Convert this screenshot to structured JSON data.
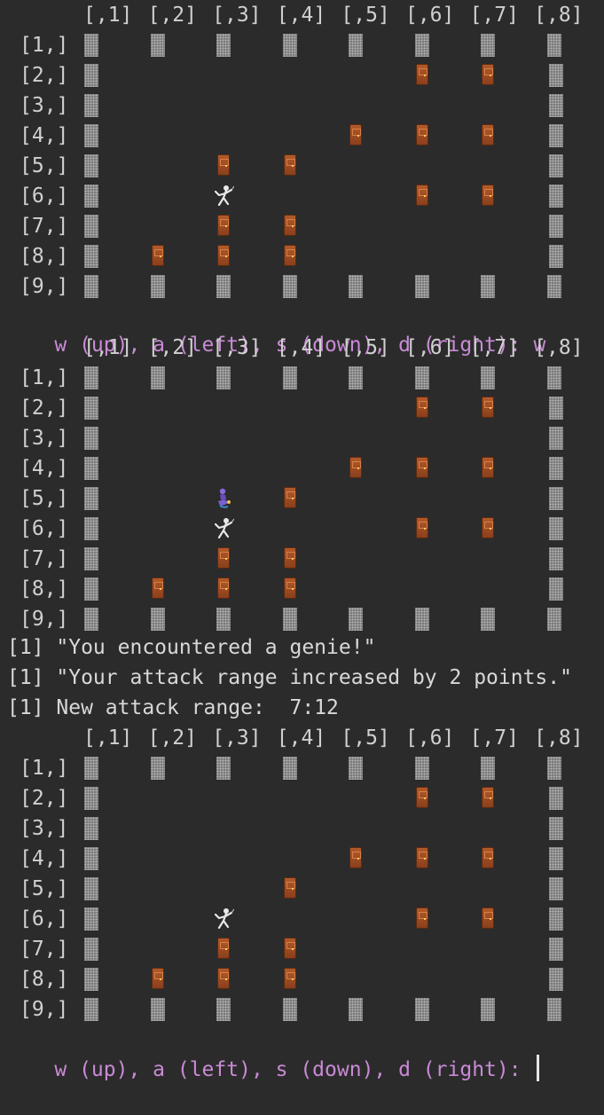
{
  "columns": [
    "[,1]",
    "[,2]",
    "[,3]",
    "[,4]",
    "[,5]",
    "[,6]",
    "[,7]",
    "[,8]"
  ],
  "rows": [
    "[1,]",
    "[2,]",
    "[3,]",
    "[4,]",
    "[5,]",
    "[6,]",
    "[7,]",
    "[8,]",
    "[9,]"
  ],
  "prompt_text": "w (up), a (left), s (down), d (right): ",
  "first_input": "w",
  "messages": [
    "[1] \"You encountered a genie!\"",
    "[1] \"Your attack range increased by 2 points.\"",
    "[1] New attack range:  7:12"
  ],
  "legend": {
    "wall_icon": "textured-wall-block",
    "door_icon": "wooden-door",
    "player_icon": "fencer",
    "genie_icon": "genie"
  },
  "colors": {
    "background": "#2b2b2b",
    "text": "#d0d0d0",
    "prompt": "#c98ad6"
  },
  "boards": [
    {
      "walls": [
        [
          1,
          1
        ],
        [
          1,
          2
        ],
        [
          1,
          3
        ],
        [
          1,
          4
        ],
        [
          1,
          5
        ],
        [
          1,
          6
        ],
        [
          1,
          7
        ],
        [
          1,
          8
        ],
        [
          2,
          1
        ],
        [
          2,
          8
        ],
        [
          3,
          1
        ],
        [
          3,
          8
        ],
        [
          4,
          1
        ],
        [
          4,
          8
        ],
        [
          5,
          1
        ],
        [
          5,
          8
        ],
        [
          6,
          1
        ],
        [
          6,
          8
        ],
        [
          7,
          1
        ],
        [
          7,
          8
        ],
        [
          8,
          1
        ],
        [
          8,
          8
        ],
        [
          9,
          1
        ],
        [
          9,
          2
        ],
        [
          9,
          3
        ],
        [
          9,
          4
        ],
        [
          9,
          5
        ],
        [
          9,
          6
        ],
        [
          9,
          7
        ],
        [
          9,
          8
        ]
      ],
      "doors": [
        [
          2,
          6
        ],
        [
          2,
          7
        ],
        [
          4,
          5
        ],
        [
          4,
          6
        ],
        [
          4,
          7
        ],
        [
          5,
          3
        ],
        [
          5,
          4
        ],
        [
          6,
          6
        ],
        [
          6,
          7
        ],
        [
          7,
          3
        ],
        [
          7,
          4
        ],
        [
          8,
          2
        ],
        [
          8,
          3
        ],
        [
          8,
          4
        ]
      ],
      "player": [
        6,
        3
      ],
      "genie": null
    },
    {
      "walls": [
        [
          1,
          1
        ],
        [
          1,
          2
        ],
        [
          1,
          3
        ],
        [
          1,
          4
        ],
        [
          1,
          5
        ],
        [
          1,
          6
        ],
        [
          1,
          7
        ],
        [
          1,
          8
        ],
        [
          2,
          1
        ],
        [
          2,
          8
        ],
        [
          3,
          1
        ],
        [
          3,
          8
        ],
        [
          4,
          1
        ],
        [
          4,
          8
        ],
        [
          5,
          1
        ],
        [
          5,
          8
        ],
        [
          6,
          1
        ],
        [
          6,
          8
        ],
        [
          7,
          1
        ],
        [
          7,
          8
        ],
        [
          8,
          1
        ],
        [
          8,
          8
        ],
        [
          9,
          1
        ],
        [
          9,
          2
        ],
        [
          9,
          3
        ],
        [
          9,
          4
        ],
        [
          9,
          5
        ],
        [
          9,
          6
        ],
        [
          9,
          7
        ],
        [
          9,
          8
        ]
      ],
      "doors": [
        [
          2,
          6
        ],
        [
          2,
          7
        ],
        [
          4,
          5
        ],
        [
          4,
          6
        ],
        [
          4,
          7
        ],
        [
          5,
          4
        ],
        [
          6,
          6
        ],
        [
          6,
          7
        ],
        [
          7,
          3
        ],
        [
          7,
          4
        ],
        [
          8,
          2
        ],
        [
          8,
          3
        ],
        [
          8,
          4
        ]
      ],
      "player": [
        6,
        3
      ],
      "genie": [
        5,
        3
      ]
    },
    {
      "walls": [
        [
          1,
          1
        ],
        [
          1,
          2
        ],
        [
          1,
          3
        ],
        [
          1,
          4
        ],
        [
          1,
          5
        ],
        [
          1,
          6
        ],
        [
          1,
          7
        ],
        [
          1,
          8
        ],
        [
          2,
          1
        ],
        [
          2,
          8
        ],
        [
          3,
          1
        ],
        [
          3,
          8
        ],
        [
          4,
          1
        ],
        [
          4,
          8
        ],
        [
          5,
          1
        ],
        [
          5,
          8
        ],
        [
          6,
          1
        ],
        [
          6,
          8
        ],
        [
          7,
          1
        ],
        [
          7,
          8
        ],
        [
          8,
          1
        ],
        [
          8,
          8
        ],
        [
          9,
          1
        ],
        [
          9,
          2
        ],
        [
          9,
          3
        ],
        [
          9,
          4
        ],
        [
          9,
          5
        ],
        [
          9,
          6
        ],
        [
          9,
          7
        ],
        [
          9,
          8
        ]
      ],
      "doors": [
        [
          2,
          6
        ],
        [
          2,
          7
        ],
        [
          4,
          5
        ],
        [
          4,
          6
        ],
        [
          4,
          7
        ],
        [
          5,
          4
        ],
        [
          6,
          6
        ],
        [
          6,
          7
        ],
        [
          7,
          3
        ],
        [
          7,
          4
        ],
        [
          8,
          2
        ],
        [
          8,
          3
        ],
        [
          8,
          4
        ]
      ],
      "player": [
        6,
        3
      ],
      "genie": null
    }
  ]
}
